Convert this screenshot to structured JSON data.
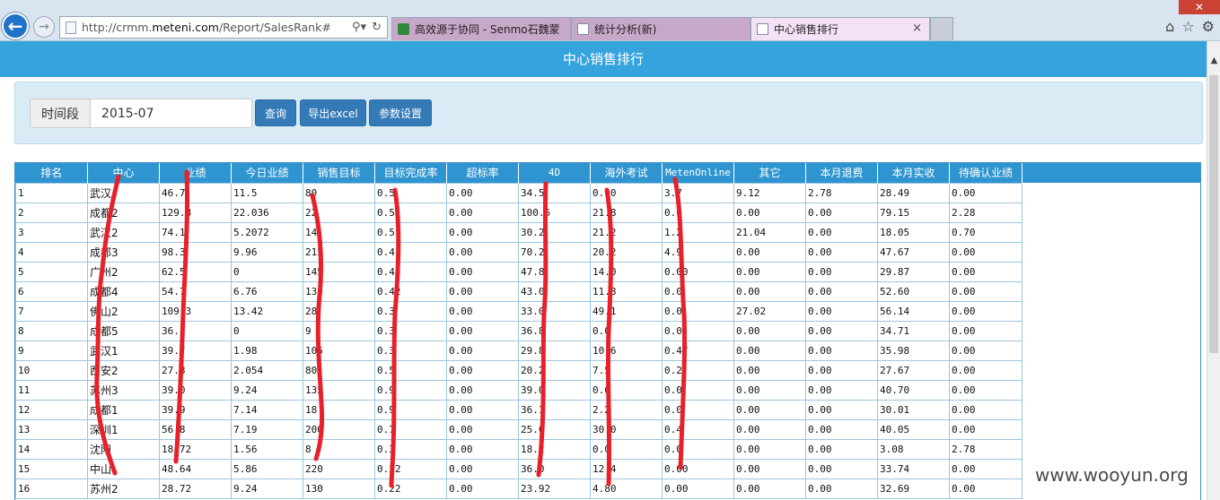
{
  "browser": {
    "url_prefix": "http://crmm.",
    "url_domain": "meteni.com",
    "url_path": "/Report/SalesRank#",
    "tabs": [
      {
        "label": "高效源于协同 - Senmo石魏蒙"
      },
      {
        "label": "统计分析(新)"
      },
      {
        "label": "中心销售排行"
      }
    ],
    "close_tab_symbol": "×",
    "window_close_symbol": "✕"
  },
  "page": {
    "title": "中心销售排行"
  },
  "filter": {
    "period_label": "时间段",
    "period_value": "2015-07",
    "query_label": "查询",
    "export_label": "导出excel",
    "params_label": "参数设置"
  },
  "table": {
    "headers": [
      "排名",
      "中心",
      "业绩",
      "今日业绩",
      "销售目标",
      "目标完成率",
      "超标率",
      "4D",
      "海外考试",
      "MetenOnline",
      "其它",
      "本月退费",
      "本月实收",
      "待确认业绩"
    ],
    "rows": [
      [
        "1",
        "武汉",
        "46.7",
        "11.5",
        "80",
        "0.5",
        "0.00",
        "34.5",
        "0.00",
        "3.7",
        "9.12",
        "2.78",
        "28.49",
        "0.00"
      ],
      [
        "2",
        "成都2",
        "129.8",
        "22.036",
        "22",
        "0.5",
        "0.00",
        "100.6",
        "21.8",
        "0.0",
        "0.00",
        "0.00",
        "79.15",
        "2.28"
      ],
      [
        "3",
        "武汉2",
        "74.1",
        "5.2072",
        "14",
        "0.5",
        "0.00",
        "30.2",
        "21.2",
        "1.2",
        "21.04",
        "0.00",
        "18.05",
        "0.70"
      ],
      [
        "4",
        "成都3",
        "98.3",
        "9.96",
        "215",
        "0.4",
        "0.00",
        "70.2",
        "20.2",
        "4.9",
        "0.00",
        "0.00",
        "47.67",
        "0.00"
      ],
      [
        "5",
        "广州2",
        "62.5",
        "0",
        "145",
        "0.43",
        "0.00",
        "47.8",
        "14.0",
        "0.00",
        "0.00",
        "0.00",
        "29.87",
        "0.00"
      ],
      [
        "6",
        "成都4",
        "54.7",
        "6.76",
        "130",
        "0.42",
        "0.00",
        "43.0",
        "11.8",
        "0.0",
        "0.00",
        "0.00",
        "52.60",
        "0.00"
      ],
      [
        "7",
        "佛山2",
        "109.3",
        "13.42",
        "28",
        "0.3",
        "0.00",
        "33.0",
        "49.1",
        "0.0",
        "27.02",
        "0.00",
        "56.14",
        "0.00"
      ],
      [
        "8",
        "成都5",
        "36.1",
        "0",
        "9",
        "0.3",
        "0.00",
        "36.8",
        "0.0",
        "0.0",
        "0.00",
        "0.00",
        "34.71",
        "0.00"
      ],
      [
        "9",
        "武汉1",
        "39.7",
        "1.98",
        "105",
        "0.3",
        "0.00",
        "29.8",
        "10.6",
        "0.47",
        "0.00",
        "0.00",
        "35.98",
        "0.00"
      ],
      [
        "10",
        "西安2",
        "27.8",
        "2.054",
        "80",
        "0.5",
        "0.00",
        "20.2",
        "7.5",
        "0.2",
        "0.00",
        "0.00",
        "27.67",
        "0.00"
      ],
      [
        "11",
        "苏州3",
        "39.0",
        "9.24",
        "135",
        "0.9",
        "0.00",
        "39.0",
        "0.0",
        "0.0",
        "0.00",
        "0.00",
        "40.70",
        "0.00"
      ],
      [
        "12",
        "成都1",
        "39.9",
        "7.14",
        "18",
        "0.9",
        "0.00",
        "36.1",
        "2.2",
        "0.0",
        "0.00",
        "0.00",
        "30.01",
        "0.00"
      ],
      [
        "13",
        "深圳1",
        "56.8",
        "7.19",
        "200",
        "0.7",
        "0.00",
        "25.0",
        "30.0",
        "0.4",
        "0.00",
        "0.00",
        "40.05",
        "0.00"
      ],
      [
        "14",
        "沈阳",
        "18.72",
        "1.56",
        "8",
        "0.3",
        "0.00",
        "18.2",
        "0.0",
        "0.0",
        "0.00",
        "0.00",
        "3.08",
        "2.78"
      ],
      [
        "15",
        "中山",
        "48.64",
        "5.86",
        "220",
        "0.22",
        "0.00",
        "36.0",
        "12.4",
        "0.00",
        "0.00",
        "0.00",
        "33.74",
        "0.00"
      ],
      [
        "16",
        "苏州2",
        "28.72",
        "9.24",
        "130",
        "0.22",
        "0.00",
        "23.92",
        "4.80",
        "0.00",
        "0.00",
        "0.00",
        "32.69",
        "0.00"
      ]
    ]
  },
  "watermark": "www.wooyun.org",
  "colors": {
    "title_bar": "#35a4dd",
    "table_header": "#2f95d0",
    "button": "#337ab7",
    "redaction": "#e8202a"
  }
}
